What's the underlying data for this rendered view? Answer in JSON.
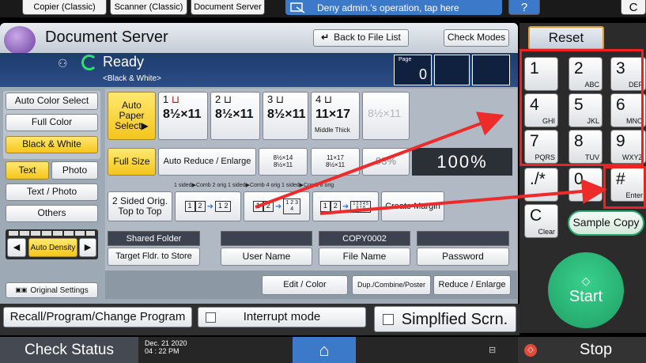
{
  "top_tabs": [
    "Copier (Classic)",
    "Scanner (Classic)",
    "Document Server"
  ],
  "deny_notice": "Deny admin.'s operation, tap here",
  "help_label": "?",
  "app_title": "Document Server",
  "back_to_file_list": "Back to File List",
  "check_modes": "Check Modes",
  "status": {
    "ready": "Ready",
    "sub": "<Black & White>"
  },
  "page": {
    "label": "Page",
    "value": "0"
  },
  "color": {
    "auto": "Auto Color Select",
    "full": "Full Color",
    "bw": "Black & White"
  },
  "original_type": {
    "text": "Text",
    "photo": "Photo",
    "text_photo": "Text / Photo",
    "others": "Others"
  },
  "density": "Auto Density",
  "original_settings": "Original Settings",
  "paper": {
    "auto": "Auto Paper Select▶",
    "trays": [
      {
        "num": "1",
        "size": "8½×11",
        "note": ""
      },
      {
        "num": "2",
        "size": "8½×11",
        "note": ""
      },
      {
        "num": "3",
        "size": "8½×11",
        "note": ""
      },
      {
        "num": "4",
        "size": "11×17",
        "note": "Middle Thick"
      }
    ],
    "bypass_size": "8½×11"
  },
  "reduce": {
    "full_size": "Full Size",
    "auto_reduce": "Auto Reduce / Enlarge",
    "preset1_top": "8½×14",
    "preset1_bottom": "8½×11",
    "preset2_top": "11×17",
    "preset2_bottom": "8½×11",
    "preset3": "93%",
    "ratio": "100%"
  },
  "duplex": {
    "header": "1 sided▶Comb 2 orig 1 sided▶Comb 4 orig 1 sided▶Comb 8 orig",
    "two_sided": "2 Sided Orig. Top to Top",
    "create_margin": "Create Margin",
    "icon_a1": "1",
    "icon_a2": "2",
    "icon_a3": "1 2",
    "icon_b1": "1",
    "icon_b2": "2",
    "icon_b3": "1 2 3 4",
    "icon_c1": "1",
    "icon_c2": "2",
    "icon_c3": "1 2 3 4 5 6 7 8"
  },
  "store": {
    "shared": "Shared Folder",
    "target": "Target Fldr. to Store",
    "user_name": "User Name",
    "file_value": "COPY0002",
    "file_name": "File Name",
    "password": "Password"
  },
  "functions": {
    "edit": "Edit / Color",
    "dup": "Dup./Combine/Poster",
    "reduce": "Reduce / Enlarge"
  },
  "recall": "Recall/Program/Change Program",
  "interrupt": "Interrupt mode",
  "simplified": "Simplfied Scrn.",
  "reset": "Reset",
  "keys": [
    {
      "n": "1",
      "s": ""
    },
    {
      "n": "2",
      "s": "ABC"
    },
    {
      "n": "3",
      "s": "DEF"
    },
    {
      "n": "4",
      "s": "GHI"
    },
    {
      "n": "5",
      "s": "JKL"
    },
    {
      "n": "6",
      "s": "MNO"
    },
    {
      "n": "7",
      "s": "PQRS"
    },
    {
      "n": "8",
      "s": "TUV"
    },
    {
      "n": "9",
      "s": "WXYZ"
    },
    {
      "n": "./*",
      "s": ""
    },
    {
      "n": "0",
      "s": ""
    },
    {
      "n": "#",
      "s": "Enter"
    }
  ],
  "clear": {
    "n": "C",
    "s": "Clear"
  },
  "sample_copy": "Sample Copy",
  "start": "Start",
  "stop": "Stop",
  "check_status": "Check Status",
  "datetime": {
    "date": "Dec. 21 2020",
    "time": "04 : 22 PM"
  },
  "colors": {
    "accent_red": "#ee2222",
    "start_green": "#2bbf7c",
    "header_blue": "#23467d"
  }
}
